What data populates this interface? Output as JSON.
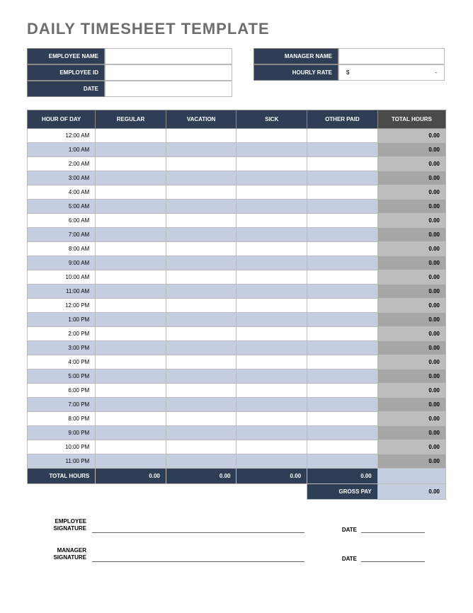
{
  "title": "DAILY TIMESHEET TEMPLATE",
  "info": {
    "emp_name_label": "EMPLOYEE NAME",
    "emp_name_value": "",
    "mgr_name_label": "MANAGER NAME",
    "mgr_name_value": "",
    "emp_id_label": "EMPLOYEE ID",
    "emp_id_value": "",
    "hourly_rate_label": "HOURLY RATE",
    "hourly_rate_currency": "$",
    "hourly_rate_value": "-",
    "date_label": "DATE",
    "date_value": ""
  },
  "columns": {
    "hour": "HOUR OF DAY",
    "regular": "REGULAR",
    "vacation": "VACATION",
    "sick": "SICK",
    "other": "OTHER PAID",
    "total": "TOTAL HOURS"
  },
  "hours": [
    {
      "label": "12:00 AM",
      "regular": "",
      "vacation": "",
      "sick": "",
      "other": "",
      "total": "0.00"
    },
    {
      "label": "1:00 AM",
      "regular": "",
      "vacation": "",
      "sick": "",
      "other": "",
      "total": "0.00"
    },
    {
      "label": "2:00 AM",
      "regular": "",
      "vacation": "",
      "sick": "",
      "other": "",
      "total": "0.00"
    },
    {
      "label": "3:00 AM",
      "regular": "",
      "vacation": "",
      "sick": "",
      "other": "",
      "total": "0.00"
    },
    {
      "label": "4:00 AM",
      "regular": "",
      "vacation": "",
      "sick": "",
      "other": "",
      "total": "0.00"
    },
    {
      "label": "5:00 AM",
      "regular": "",
      "vacation": "",
      "sick": "",
      "other": "",
      "total": "0.00"
    },
    {
      "label": "6:00 AM",
      "regular": "",
      "vacation": "",
      "sick": "",
      "other": "",
      "total": "0.00"
    },
    {
      "label": "7:00 AM",
      "regular": "",
      "vacation": "",
      "sick": "",
      "other": "",
      "total": "0.00"
    },
    {
      "label": "8:00 AM",
      "regular": "",
      "vacation": "",
      "sick": "",
      "other": "",
      "total": "0.00"
    },
    {
      "label": "9:00 AM",
      "regular": "",
      "vacation": "",
      "sick": "",
      "other": "",
      "total": "0.00"
    },
    {
      "label": "10:00 AM",
      "regular": "",
      "vacation": "",
      "sick": "",
      "other": "",
      "total": "0.00"
    },
    {
      "label": "11:00 AM",
      "regular": "",
      "vacation": "",
      "sick": "",
      "other": "",
      "total": "0.00"
    },
    {
      "label": "12:00 PM",
      "regular": "",
      "vacation": "",
      "sick": "",
      "other": "",
      "total": "0.00"
    },
    {
      "label": "1:00 PM",
      "regular": "",
      "vacation": "",
      "sick": "",
      "other": "",
      "total": "0.00"
    },
    {
      "label": "2:00 PM",
      "regular": "",
      "vacation": "",
      "sick": "",
      "other": "",
      "total": "0.00"
    },
    {
      "label": "3:00 PM",
      "regular": "",
      "vacation": "",
      "sick": "",
      "other": "",
      "total": "0.00"
    },
    {
      "label": "4:00 PM",
      "regular": "",
      "vacation": "",
      "sick": "",
      "other": "",
      "total": "0.00"
    },
    {
      "label": "5:00 PM",
      "regular": "",
      "vacation": "",
      "sick": "",
      "other": "",
      "total": "0.00"
    },
    {
      "label": "6:00 PM",
      "regular": "",
      "vacation": "",
      "sick": "",
      "other": "",
      "total": "0.00"
    },
    {
      "label": "7:00 PM",
      "regular": "",
      "vacation": "",
      "sick": "",
      "other": "",
      "total": "0.00"
    },
    {
      "label": "8:00 PM",
      "regular": "",
      "vacation": "",
      "sick": "",
      "other": "",
      "total": "0.00"
    },
    {
      "label": "9:00 PM",
      "regular": "",
      "vacation": "",
      "sick": "",
      "other": "",
      "total": "0.00"
    },
    {
      "label": "10:00 PM",
      "regular": "",
      "vacation": "",
      "sick": "",
      "other": "",
      "total": "0.00"
    },
    {
      "label": "11:00 PM",
      "regular": "",
      "vacation": "",
      "sick": "",
      "other": "",
      "total": "0.00"
    }
  ],
  "totals": {
    "label": "TOTAL HOURS",
    "regular": "0.00",
    "vacation": "0.00",
    "sick": "0.00",
    "other": "0.00",
    "total": ""
  },
  "gross": {
    "label": "GROSS PAY",
    "value": "0.00"
  },
  "signatures": {
    "emp_label": "EMPLOYEE SIGNATURE",
    "mgr_label": "MANAGER SIGNATURE",
    "date_label": "DATE"
  }
}
